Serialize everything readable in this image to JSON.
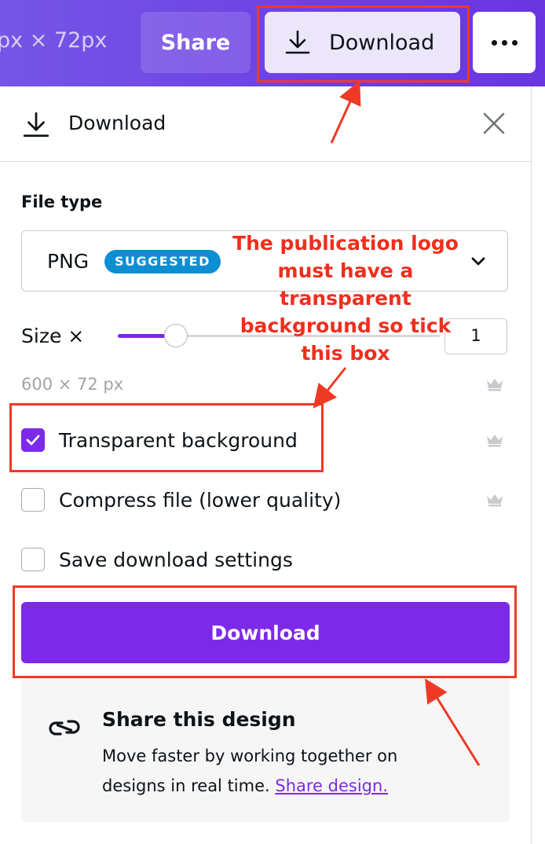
{
  "topbar": {
    "dimensions": "px × 72px",
    "share_label": "Share",
    "download_label": "Download",
    "more_icon": "more-horizontal-icon"
  },
  "panel": {
    "title": "Download",
    "file_type_label": "File type",
    "file_type_value": "PNG",
    "file_type_badge": "SUGGESTED",
    "size_label": "Size ×",
    "size_value": "1",
    "size_slider_fraction": 0.18,
    "dimensions_readout": "600 × 72 px",
    "options": [
      {
        "label": "Transparent background",
        "checked": true
      },
      {
        "label": "Compress file (lower quality)",
        "checked": false
      },
      {
        "label": "Save download settings",
        "checked": false
      }
    ],
    "download_button": "Download",
    "share_card": {
      "title": "Share this design",
      "body": "Move faster by working together on designs in real time. ",
      "link": "Share design."
    }
  },
  "annotation": {
    "text": "The publication logo must have a transparent background so tick this box"
  },
  "colors": {
    "brand_purple": "#7d2ae8",
    "badge_blue": "#0b8ed2",
    "annotation_red": "#ee3a25"
  }
}
